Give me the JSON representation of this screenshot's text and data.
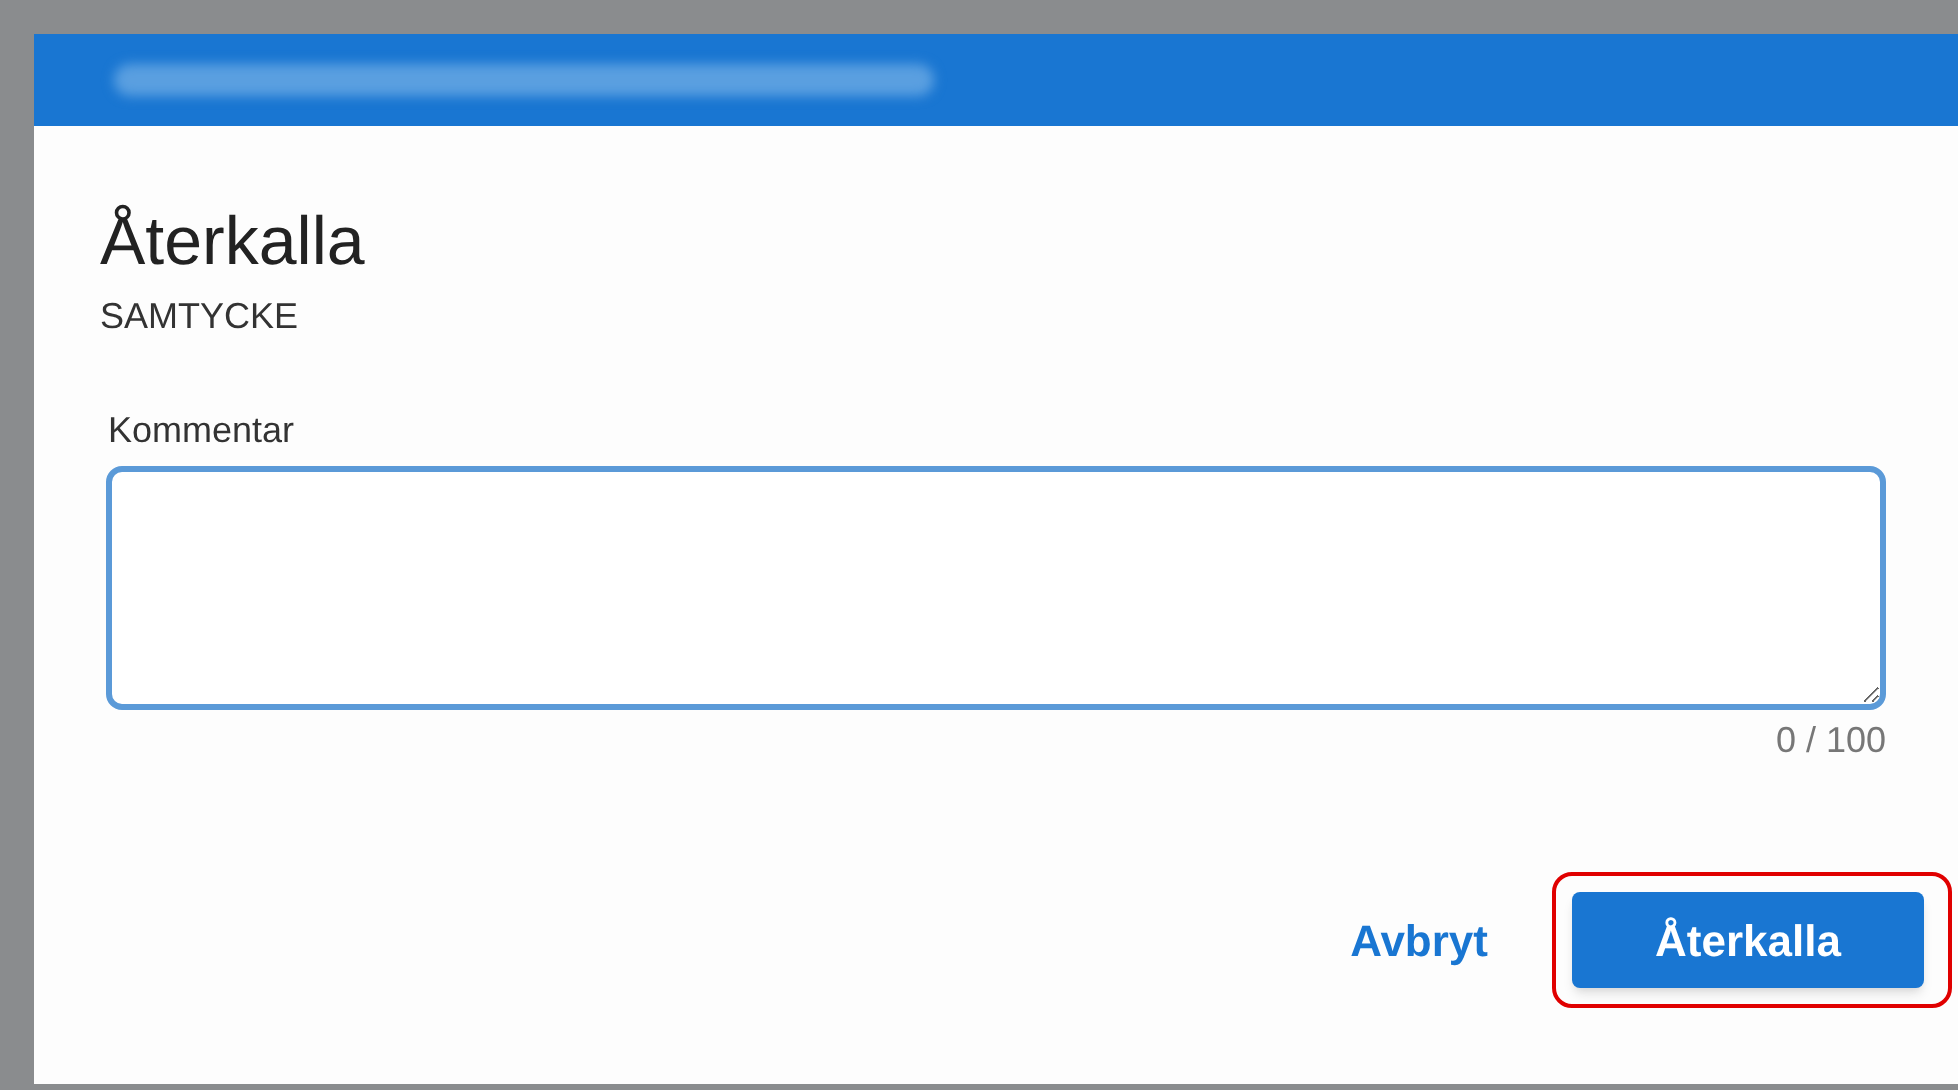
{
  "dialog": {
    "title": "Återkalla",
    "subtitle": "SAMTYCKE",
    "comment": {
      "label": "Kommentar",
      "focused": true,
      "counter": "0 / 100"
    },
    "buttons": [
      {
        "kind": "text",
        "label": "Avbryt",
        "highlighted": false
      },
      {
        "kind": "filled",
        "label": "Återkalla",
        "highlighted": true
      }
    ]
  }
}
